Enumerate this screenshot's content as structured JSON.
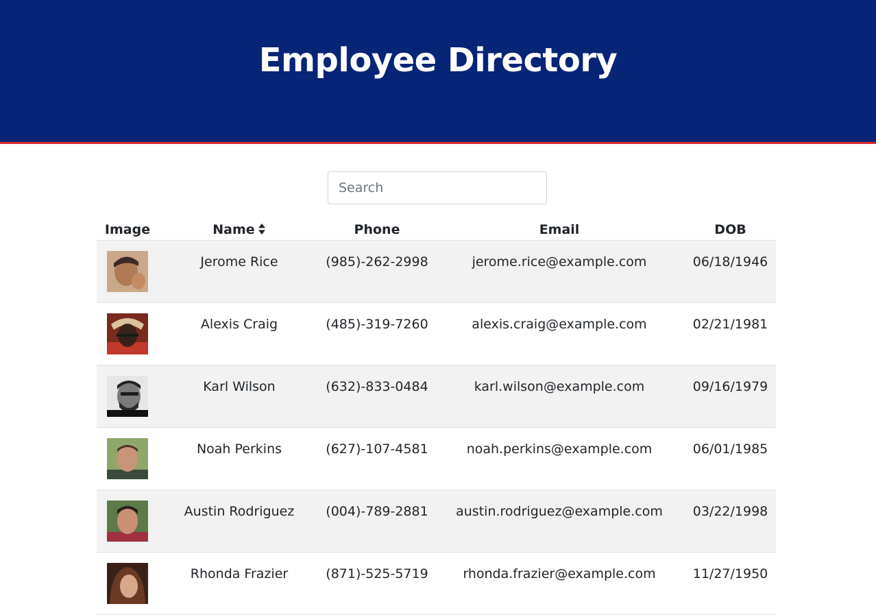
{
  "header": {
    "title": "Employee Directory",
    "bg_color": "#062576",
    "accent_color": "#d62b2b"
  },
  "search": {
    "placeholder": "Search",
    "value": ""
  },
  "table": {
    "columns": {
      "image": "Image",
      "name": "Name",
      "phone": "Phone",
      "email": "Email",
      "dob": "DOB"
    },
    "sort_icon": "sort-icon",
    "rows": [
      {
        "name": "Jerome Rice",
        "phone": "(985)-262-2998",
        "email": "jerome.rice@example.com",
        "dob": "06/18/1946",
        "avatar_color": "#b78a64"
      },
      {
        "name": "Alexis Craig",
        "phone": "(485)-319-7260",
        "email": "alexis.craig@example.com",
        "dob": "02/21/1981",
        "avatar_color": "#6b3a2a"
      },
      {
        "name": "Karl Wilson",
        "phone": "(632)-833-0484",
        "email": "karl.wilson@example.com",
        "dob": "09/16/1979",
        "avatar_color": "#6e6e6e"
      },
      {
        "name": "Noah Perkins",
        "phone": "(627)-107-4581",
        "email": "noah.perkins@example.com",
        "dob": "06/01/1985",
        "avatar_color": "#6f8a4e"
      },
      {
        "name": "Austin Rodriguez",
        "phone": "(004)-789-2881",
        "email": "austin.rodriguez@example.com",
        "dob": "03/22/1998",
        "avatar_color": "#8a5a48"
      },
      {
        "name": "Rhonda Frazier",
        "phone": "(871)-525-5719",
        "email": "rhonda.frazier@example.com",
        "dob": "11/27/1950",
        "avatar_color": "#5a3526"
      }
    ]
  }
}
